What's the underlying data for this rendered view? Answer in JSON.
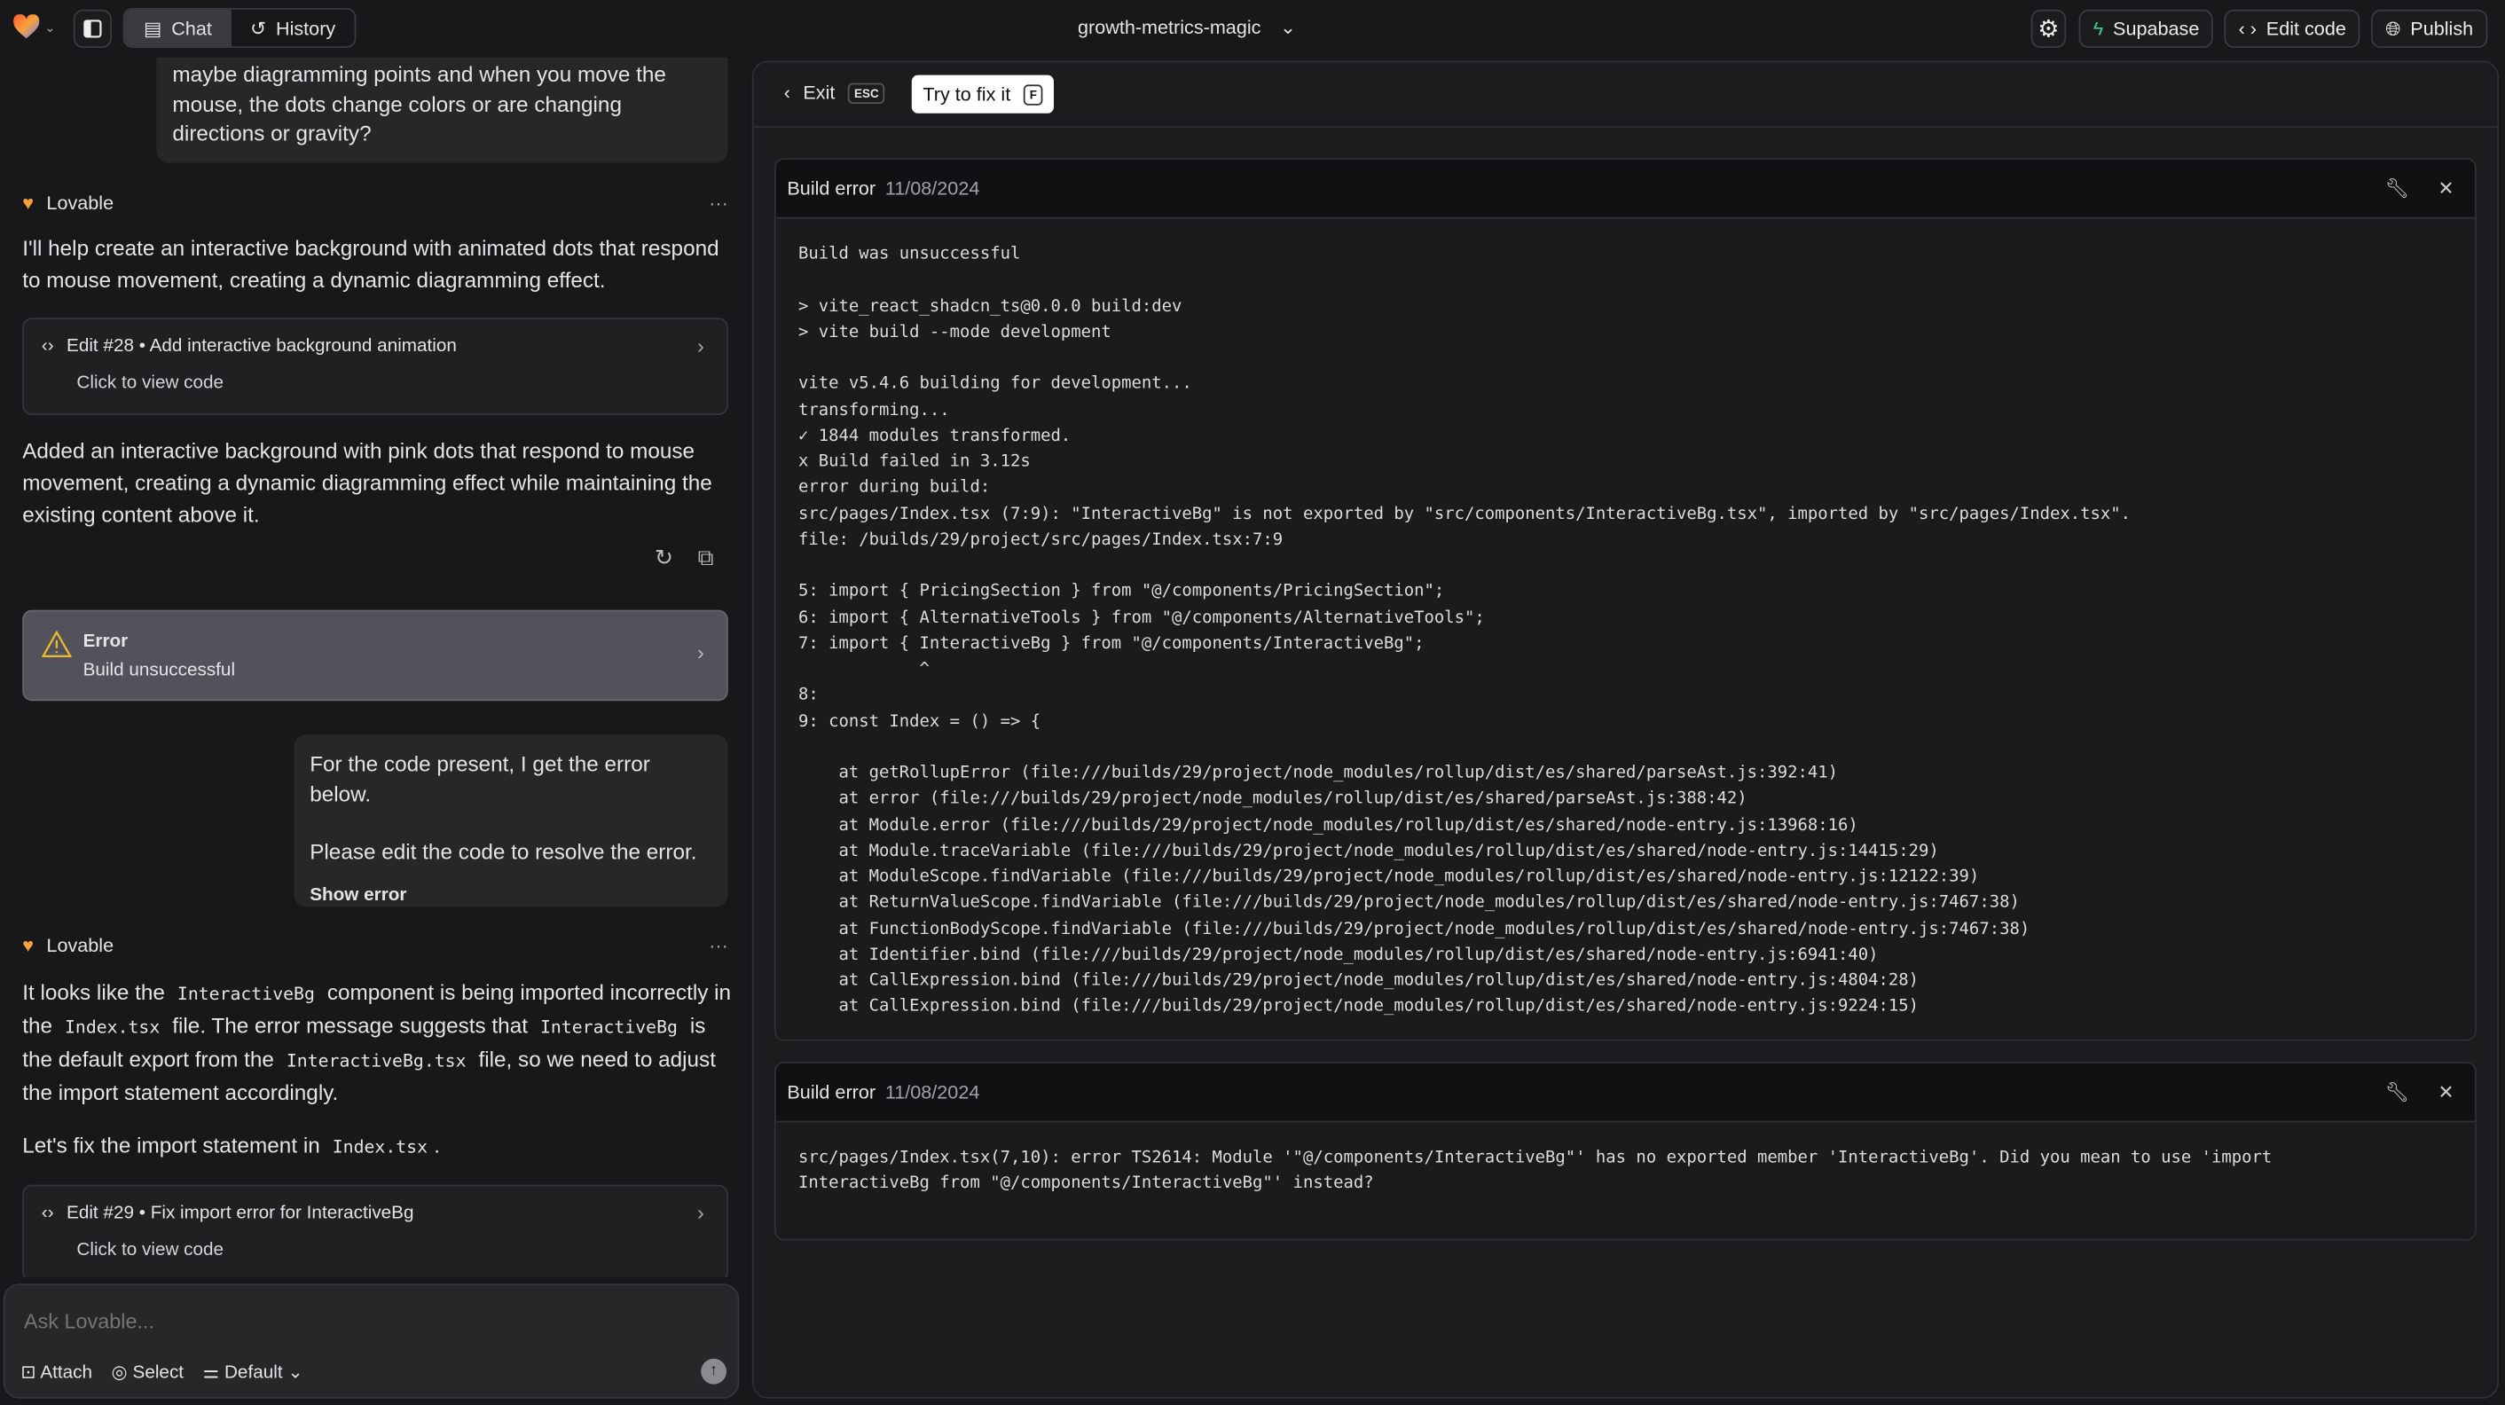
{
  "topbar": {
    "project_name": "growth-metrics-magic",
    "tabs": [
      {
        "label": "Chat",
        "active": true
      },
      {
        "label": "History",
        "active": false
      }
    ],
    "supabase_label": "Supabase",
    "edit_code_label": "Edit code",
    "publish_label": "Publish",
    "supabase_color": "#3ecf8e"
  },
  "chat": {
    "user_msg_1": "maybe diagramming points and when you move the mouse, the dots change colors or are changing directions or gravity?",
    "assistant_name": "Lovable",
    "assistant_msg_1": "I'll help create an interactive background with animated dots that respond to mouse movement, creating a dynamic diagramming effect.",
    "edit_28": {
      "title": "Edit #28 • Add interactive background animation",
      "sub": "Click to view code"
    },
    "assistant_msg_1b": "Added an interactive background with pink dots that respond to mouse movement, creating a dynamic diagramming effect while maintaining the existing content above it.",
    "error_card": {
      "title": "Error",
      "sub": "Build unsuccessful",
      "icon_color": "#e8b931"
    },
    "user_msg_2a": "For the code present, I get the error below.",
    "user_msg_2b": "Please edit the code to resolve the error.",
    "show_error": "Show error",
    "assistant_msg_2": {
      "t1": "It looks like the",
      "c1": "InteractiveBg",
      "t2": "component is being imported incorrectly in the",
      "c2": "Index.tsx",
      "t3": "file. The error message suggests that",
      "c3": "InteractiveBg",
      "t4": "is the default export from the",
      "c4": "InteractiveBg.tsx",
      "t5": "file, so we need to adjust the import statement accordingly."
    },
    "assistant_msg_2b": {
      "t1": "Let's fix the import statement in",
      "c1": "Index.tsx",
      "t2": "."
    },
    "edit_29": {
      "title": "Edit #29 • Fix import error for InteractiveBg",
      "sub": "Click to view code"
    }
  },
  "composer": {
    "placeholder": "Ask Lovable...",
    "attach": "Attach",
    "select": "Select",
    "mode": "Default"
  },
  "error_view": {
    "exit_label": "Exit",
    "exit_key": "ESC",
    "fix_label": "Try to fix it",
    "fix_key": "F",
    "panels": [
      {
        "title": "Build error",
        "date": "11/08/2024",
        "lines": [
          "Build was unsuccessful",
          "",
          "> vite_react_shadcn_ts@0.0.0 build:dev",
          "> vite build --mode development",
          "",
          "vite v5.4.6 building for development...",
          "transforming...",
          "✓ 1844 modules transformed.",
          "x Build failed in 3.12s",
          "error during build:",
          "src/pages/Index.tsx (7:9): \"InteractiveBg\" is not exported by \"src/components/InteractiveBg.tsx\", imported by \"src/pages/Index.tsx\".",
          "file: /builds/29/project/src/pages/Index.tsx:7:9",
          "",
          "5: import { PricingSection } from \"@/components/PricingSection\";",
          "6: import { AlternativeTools } from \"@/components/AlternativeTools\";",
          "7: import { InteractiveBg } from \"@/components/InteractiveBg\";",
          "            ^",
          "8:",
          "9: const Index = () => {",
          "",
          "    at getRollupError (file:///builds/29/project/node_modules/rollup/dist/es/shared/parseAst.js:392:41)",
          "    at error (file:///builds/29/project/node_modules/rollup/dist/es/shared/parseAst.js:388:42)",
          "    at Module.error (file:///builds/29/project/node_modules/rollup/dist/es/shared/node-entry.js:13968:16)",
          "    at Module.traceVariable (file:///builds/29/project/node_modules/rollup/dist/es/shared/node-entry.js:14415:29)",
          "    at ModuleScope.findVariable (file:///builds/29/project/node_modules/rollup/dist/es/shared/node-entry.js:12122:39)",
          "    at ReturnValueScope.findVariable (file:///builds/29/project/node_modules/rollup/dist/es/shared/node-entry.js:7467:38)",
          "    at FunctionBodyScope.findVariable (file:///builds/29/project/node_modules/rollup/dist/es/shared/node-entry.js:7467:38)",
          "    at Identifier.bind (file:///builds/29/project/node_modules/rollup/dist/es/shared/node-entry.js:6941:40)",
          "    at CallExpression.bind (file:///builds/29/project/node_modules/rollup/dist/es/shared/node-entry.js:4804:28)",
          "    at CallExpression.bind (file:///builds/29/project/node_modules/rollup/dist/es/shared/node-entry.js:9224:15)"
        ]
      },
      {
        "title": "Build error",
        "date": "11/08/2024",
        "lines": [
          "src/pages/Index.tsx(7,10): error TS2614: Module '\"@/components/InteractiveBg\"' has no exported member 'InteractiveBg'. Did you mean to use 'import",
          "InteractiveBg from \"@/components/InteractiveBg\"' instead?"
        ]
      }
    ]
  }
}
